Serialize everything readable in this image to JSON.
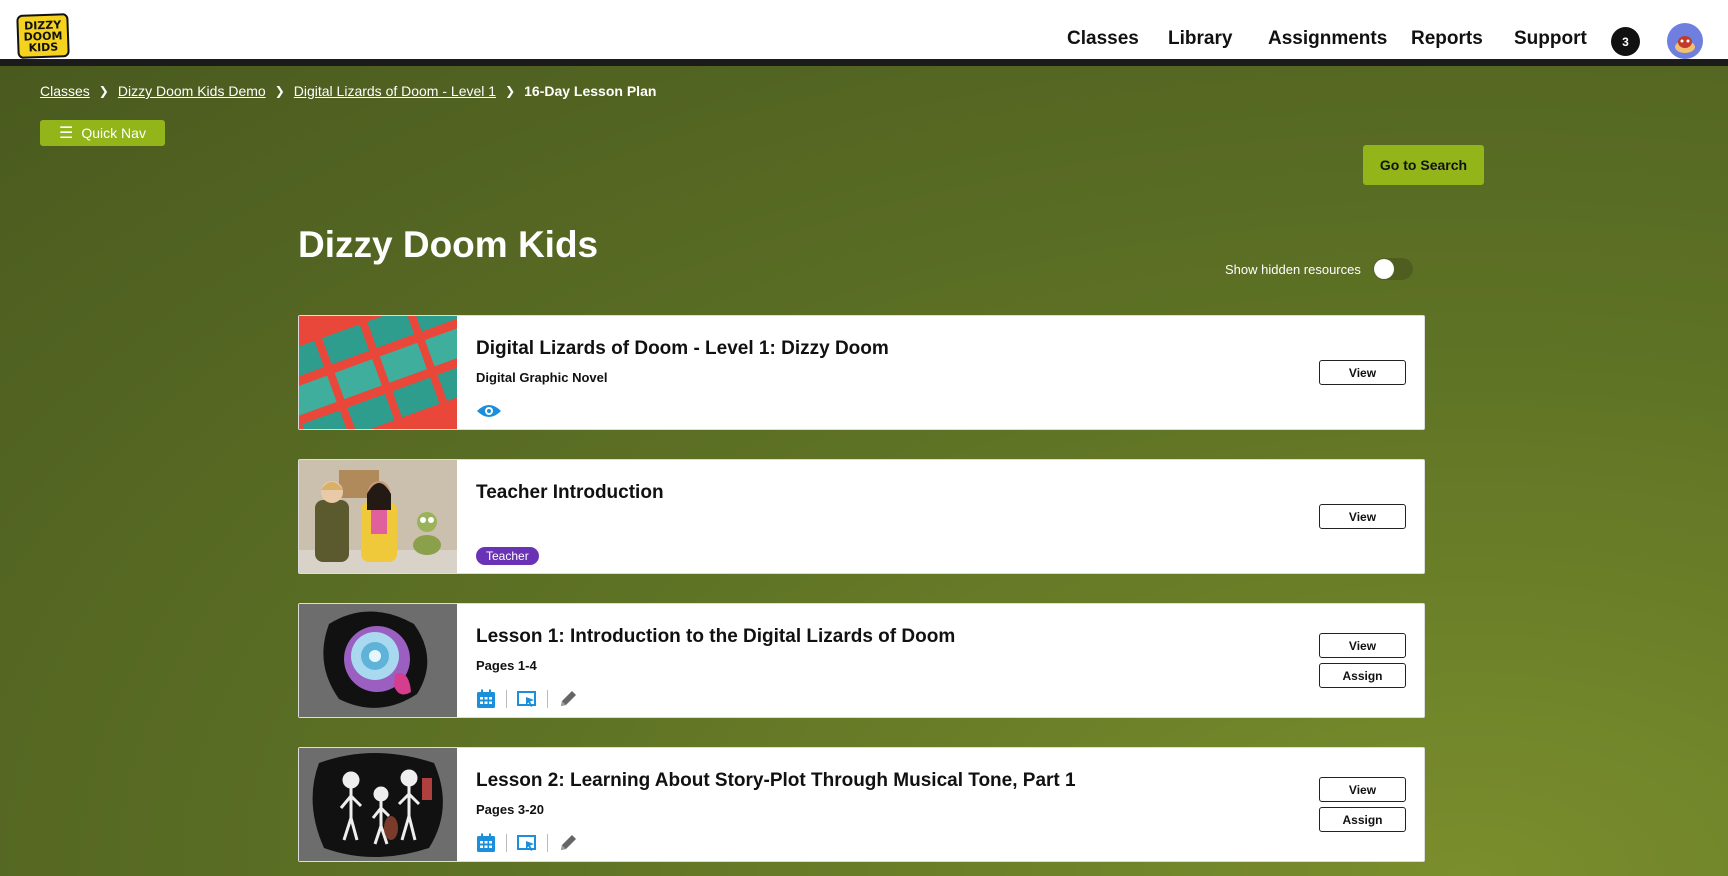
{
  "header": {
    "logo_text": [
      "DIZZY",
      "DOOM",
      "KIDS"
    ],
    "nav": [
      {
        "label": "Classes"
      },
      {
        "label": "Library"
      },
      {
        "label": "Assignments"
      },
      {
        "label": "Reports"
      },
      {
        "label": "Support"
      }
    ],
    "notification_count": "3"
  },
  "breadcrumb": {
    "items": [
      "Classes",
      "Dizzy Doom Kids Demo",
      "Digital Lizards of Doom - Level 1"
    ],
    "current": "16-Day Lesson Plan"
  },
  "quick_nav_label": "Quick Nav",
  "go_to_search_label": "Go to Search",
  "page_title": "Dizzy Doom Kids",
  "show_hidden_label": "Show hidden resources",
  "cards": [
    {
      "title": "Digital Lizards of Doom - Level 1: Dizzy Doom",
      "subtitle": "Digital Graphic Novel",
      "view_label": "View"
    },
    {
      "title": "Teacher Introduction",
      "tag": "Teacher",
      "view_label": "View"
    },
    {
      "title": "Lesson 1: Introduction to the Digital Lizards of Doom",
      "subtitle": "Pages 1-4",
      "view_label": "View",
      "assign_label": "Assign"
    },
    {
      "title": "Lesson 2: Learning About Story-Plot Through Musical Tone, Part 1",
      "subtitle": "Pages 3-20",
      "view_label": "View",
      "assign_label": "Assign"
    }
  ],
  "colors": {
    "accent_green": "#93b51a",
    "icon_blue": "#1a8fdc",
    "teacher_purple": "#6a33b5",
    "background_olive": "#5f7325"
  }
}
